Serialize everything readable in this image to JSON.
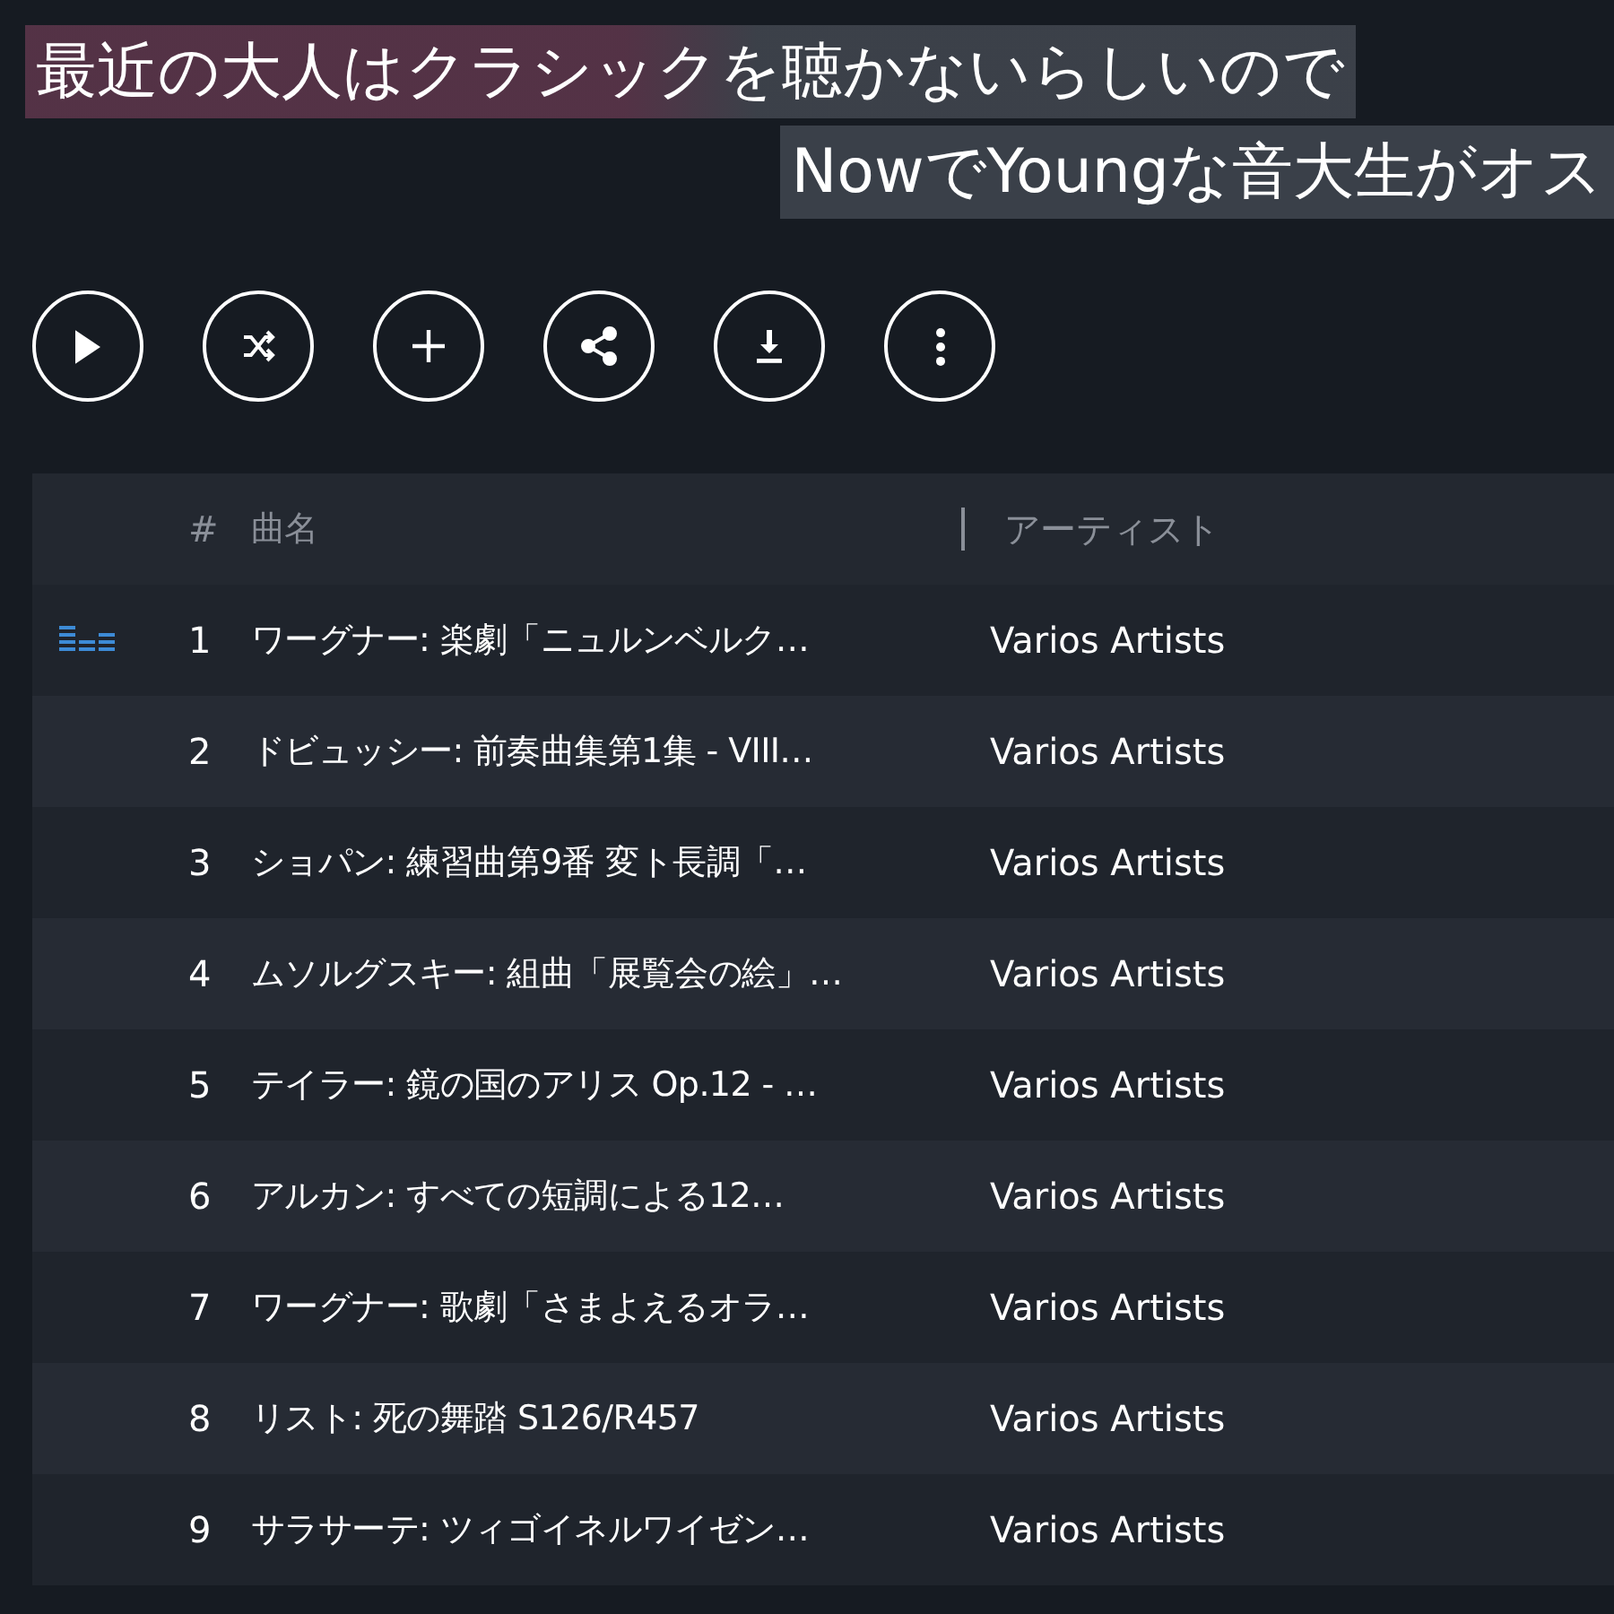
{
  "header": {
    "title_lines": [
      "最近の大人はクラシックを聴かないらしいので",
      "NowでYoungな音大生がオス"
    ]
  },
  "actions": [
    {
      "kind": "play"
    },
    {
      "kind": "shuffle"
    },
    {
      "kind": "add"
    },
    {
      "kind": "share"
    },
    {
      "kind": "download"
    },
    {
      "kind": "more"
    }
  ],
  "table": {
    "columns": [
      "#",
      "曲名",
      "アーティスト"
    ],
    "rows": [
      {
        "number": "1",
        "title": "ワーグナー: 楽劇「ニュルンベルク…",
        "artist": "Varios Artists",
        "playing": true
      },
      {
        "number": "2",
        "title": "ドビュッシー: 前奏曲集第1集 - VIII…",
        "artist": "Varios Artists",
        "playing": false
      },
      {
        "number": "3",
        "title": "ショパン: 練習曲第9番 変ト長調「…",
        "artist": "Varios Artists",
        "playing": false
      },
      {
        "number": "4",
        "title": "ムソルグスキー: 組曲「展覧会の絵」…",
        "artist": "Varios Artists",
        "playing": false
      },
      {
        "number": "5",
        "title": "テイラー: 鏡の国のアリス Op.12 - …",
        "artist": "Varios Artists",
        "playing": false
      },
      {
        "number": "6",
        "title": "アルカン: すべての短調による12…",
        "artist": "Varios Artists",
        "playing": false
      },
      {
        "number": "7",
        "title": "ワーグナー: 歌劇「さまよえるオラ…",
        "artist": "Varios Artists",
        "playing": false
      },
      {
        "number": "8",
        "title": "リスト: 死の舞踏 S126/R457",
        "artist": "Varios Artists",
        "playing": false
      },
      {
        "number": "9",
        "title": "サラサーテ: ツィゴイネルワイゼン…",
        "artist": "Varios Artists",
        "playing": false
      }
    ]
  }
}
